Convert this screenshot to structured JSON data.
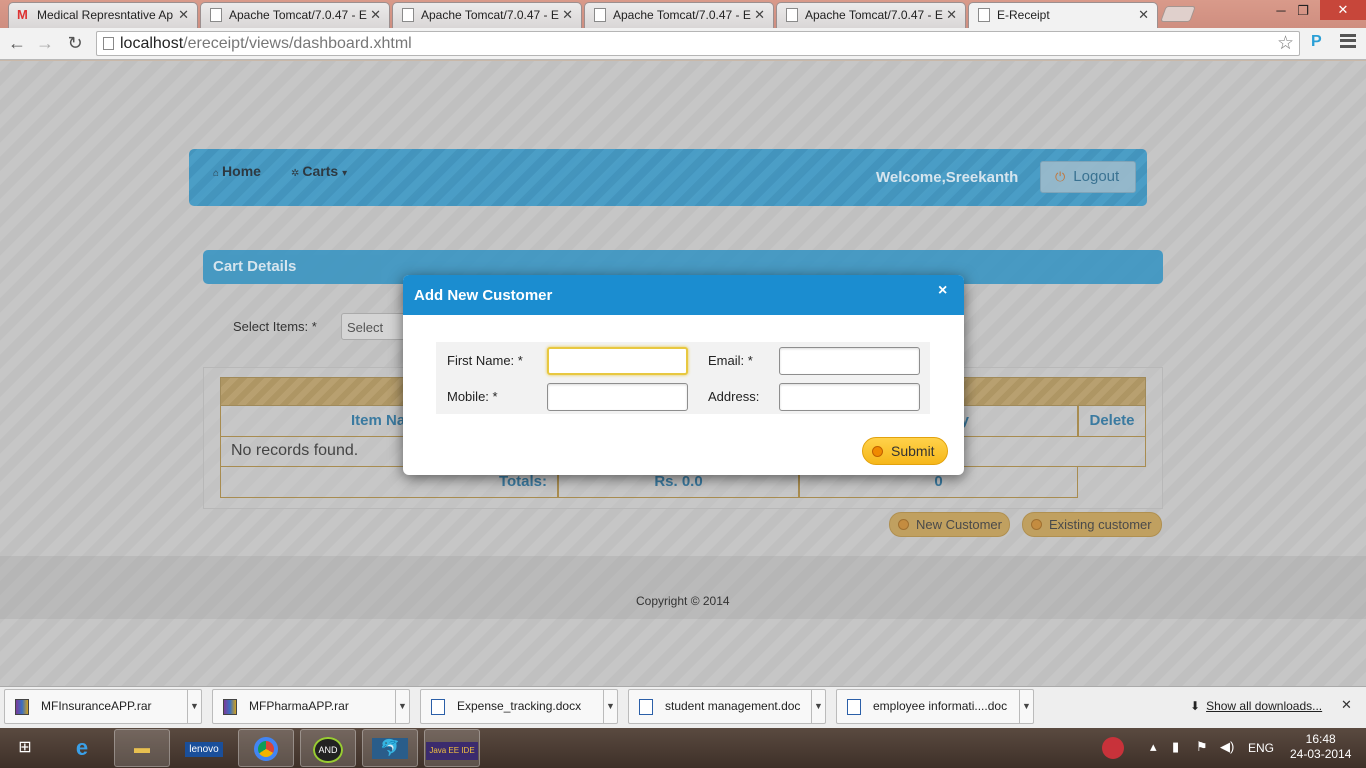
{
  "browser": {
    "tabs": [
      {
        "title": "Medical Represntative Ap",
        "icon": "gmail-icon"
      },
      {
        "title": "Apache Tomcat/7.0.47 - E",
        "icon": "page-icon"
      },
      {
        "title": "Apache Tomcat/7.0.47 - E",
        "icon": "page-icon"
      },
      {
        "title": "Apache Tomcat/7.0.47 - E",
        "icon": "page-icon"
      },
      {
        "title": "Apache Tomcat/7.0.47 - E",
        "icon": "page-icon"
      },
      {
        "title": "E-Receipt",
        "icon": "page-icon",
        "active": true
      }
    ],
    "url_host": "localhost",
    "url_path": "/ereceipt/views/dashboard.xhtml",
    "extension_label": "P"
  },
  "app": {
    "nav": {
      "home": "Home",
      "carts": "Carts",
      "welcome": "Welcome,Sreekanth",
      "logout": "Logout"
    },
    "cart": {
      "title": "Cart Details",
      "select_label": "Select Items: *",
      "select_value": "Select",
      "columns": [
        "Item Na",
        "y",
        "Delete"
      ],
      "empty": "No records found.",
      "totals_label": "Totals:",
      "totals_amount": "Rs. 0.0",
      "totals_qty": "0"
    },
    "buttons": {
      "new_customer": "New Customer",
      "existing_customer": "Existing customer"
    },
    "footer": "Copyright © 2014"
  },
  "modal": {
    "title": "Add New Customer",
    "close": "×",
    "fields": {
      "first_name": {
        "label": "First Name: *",
        "value": ""
      },
      "email": {
        "label": "Email: *",
        "value": ""
      },
      "mobile": {
        "label": "Mobile: *",
        "value": ""
      },
      "address": {
        "label": "Address:",
        "value": ""
      }
    },
    "submit": "Submit"
  },
  "downloads": {
    "items": [
      "MFInsuranceAPP.rar",
      "MFPharmaAPP.rar",
      "Expense_tracking.docx",
      "student management.doc",
      "employee  informati....doc"
    ],
    "show_all": "Show all downloads..."
  },
  "taskbar": {
    "lang": "ENG",
    "time": "16:48",
    "date": "24-03-2014"
  },
  "colors": {
    "nav_blue": "#3a95c2",
    "modal_header": "#1b8dd0",
    "submit_yellow": "#f6b71a",
    "table_gold": "#b8a070"
  }
}
